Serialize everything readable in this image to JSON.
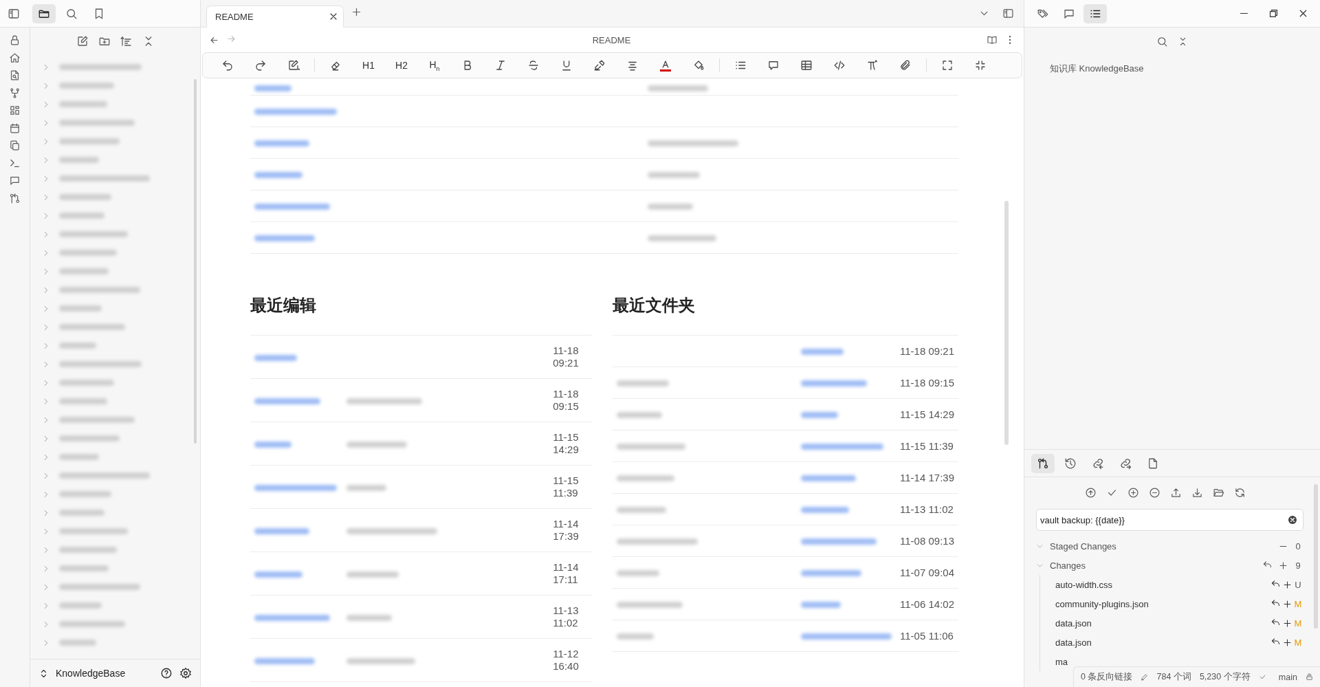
{
  "left_panel_tabs": [
    {
      "selected": true
    },
    {
      "selected": false
    },
    {
      "selected": false
    }
  ],
  "file_tree": {
    "items": [
      {
        "expanded": false
      },
      {
        "expanded": false
      },
      {
        "expanded": false
      },
      {
        "expanded": false
      },
      {
        "expanded": false
      },
      {
        "expanded": false
      },
      {
        "expanded": false
      },
      {
        "expanded": false
      },
      {
        "expanded": false
      },
      {
        "expanded": false
      },
      {
        "expanded": false
      },
      {
        "expanded": false
      },
      {
        "expanded": false
      },
      {
        "expanded": false
      },
      {
        "expanded": false
      },
      {
        "expanded": false
      },
      {
        "expanded": false
      },
      {
        "expanded": false
      },
      {
        "expanded": false
      },
      {
        "expanded": false
      },
      {
        "expanded": false
      },
      {
        "expanded": false
      },
      {
        "expanded": false
      },
      {
        "expanded": false
      },
      {
        "expanded": false
      },
      {
        "expanded": false
      },
      {
        "expanded": false
      },
      {
        "expanded": false
      },
      {
        "expanded": false
      },
      {
        "expanded": false
      },
      {
        "expanded": false
      },
      {
        "expanded": false
      }
    ]
  },
  "vault_switcher": {
    "name": "KnowledgeBase"
  },
  "editor_tabs": [
    {
      "title": "README",
      "selected": true
    }
  ],
  "note_title": "README",
  "toolbar": {
    "heading_buttons": [
      "H1",
      "H2",
      "H$_{n}$"
    ]
  },
  "link_table": {
    "rows": [
      {
        "kind": "cut",
        "link": true,
        "note": true
      },
      {
        "kind": "row",
        "link": true,
        "note": false
      },
      {
        "kind": "row",
        "link": true,
        "note": true
      },
      {
        "kind": "row",
        "link": true,
        "note": true
      },
      {
        "kind": "row",
        "link": true,
        "note": true
      },
      {
        "kind": "row",
        "link": true,
        "note": true
      }
    ]
  },
  "recent_edits": {
    "heading": "最近编辑",
    "rows": [
      {
        "link": true,
        "note": false,
        "time": "11-18 09:21"
      },
      {
        "link": true,
        "note": true,
        "time": "11-18 09:15"
      },
      {
        "link": true,
        "note": true,
        "time": "11-15 14:29"
      },
      {
        "link": true,
        "note": true,
        "time": "11-15 11:39"
      },
      {
        "link": true,
        "note": true,
        "time": "11-14 17:39"
      },
      {
        "link": true,
        "note": true,
        "time": "11-14 17:11"
      },
      {
        "link": true,
        "note": true,
        "time": "11-13 11:02"
      },
      {
        "link": true,
        "note": true,
        "time": "11-12 16:40"
      }
    ]
  },
  "recent_folders": {
    "heading": "最近文件夹",
    "rows": [
      {
        "note": false,
        "link": true,
        "time": "11-18 09:21"
      },
      {
        "note": true,
        "link": true,
        "time": "11-18 09:15"
      },
      {
        "note": true,
        "link": true,
        "time": "11-15 14:29"
      },
      {
        "note": true,
        "link": true,
        "time": "11-15 11:39"
      },
      {
        "note": true,
        "link": true,
        "time": "11-14 17:39"
      },
      {
        "note": true,
        "link": true,
        "time": "11-13 11:02"
      },
      {
        "note": true,
        "link": true,
        "time": "11-08 09:13"
      },
      {
        "note": true,
        "link": true,
        "time": "11-07 09:04"
      },
      {
        "note": true,
        "link": true,
        "time": "11-06 14:02"
      },
      {
        "note": true,
        "link": true,
        "time": "11-05 11:06"
      }
    ]
  },
  "right_panel_tabs": [
    {
      "selected": false
    },
    {
      "selected": false
    },
    {
      "selected": true
    }
  ],
  "outline": {
    "title": "知识库 KnowledgeBase"
  },
  "git": {
    "tabs": [
      {
        "selected": true
      },
      {
        "selected": false
      },
      {
        "selected": false
      },
      {
        "selected": false
      },
      {
        "selected": false
      }
    ],
    "commit_message": "vault backup: {{date}}",
    "groups": [
      {
        "kind": "staged",
        "title": "Staged Changes",
        "count": "0",
        "expanded": true
      },
      {
        "kind": "unstaged",
        "title": "Changes",
        "count": "9",
        "expanded": true,
        "files": [
          {
            "name": "auto-width.css",
            "status": "U"
          },
          {
            "name": "community-plugins.json",
            "status": "M"
          },
          {
            "name": "data.json",
            "status": "M"
          },
          {
            "name": "data.json",
            "status": "M"
          },
          {
            "name": "ma"
          }
        ]
      }
    ]
  },
  "status_bar": {
    "backlinks": "0 条反向链接",
    "words": "784 个词",
    "chars": "5,230 个字符",
    "branch": "main"
  }
}
